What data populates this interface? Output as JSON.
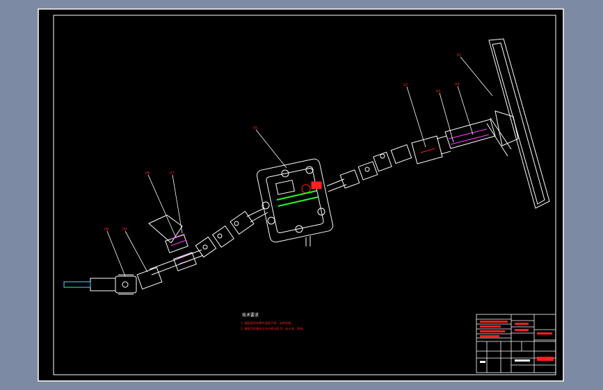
{
  "colors": {
    "app_background": "#7d8aa3",
    "canvas": "#000000",
    "frame_line": "#ffffff",
    "leader_line": "#ffffff",
    "callout_text": "#ff2020",
    "part_green": "#20ff20",
    "part_red": "#ff2020",
    "part_magenta": "#ff40ff",
    "part_cyan": "#40e0ff",
    "title_block_red": "#ff2020"
  },
  "drawing": {
    "notes_heading": "技术要求",
    "notes": [
      "1. 装配前所有零件清洗干净，去除毛刺。",
      "2. 装配后检查各万向节转动灵活，无卡滞、异响。"
    ],
    "callouts": [
      {
        "id": "c-top-right",
        "text": "01"
      },
      {
        "id": "c-steer-1",
        "text": "02"
      },
      {
        "id": "c-steer-2",
        "text": "03"
      },
      {
        "id": "c-steer-3",
        "text": "04"
      },
      {
        "id": "c-gear",
        "text": "05"
      },
      {
        "id": "c-mid-1",
        "text": "06"
      },
      {
        "id": "c-mid-2",
        "text": "07"
      },
      {
        "id": "c-low-1",
        "text": "08"
      },
      {
        "id": "c-low-2",
        "text": "09"
      }
    ]
  },
  "title_block": {
    "cells_red": [
      "",
      "",
      "",
      "",
      "",
      "",
      "",
      ""
    ],
    "title": "",
    "company": ""
  }
}
